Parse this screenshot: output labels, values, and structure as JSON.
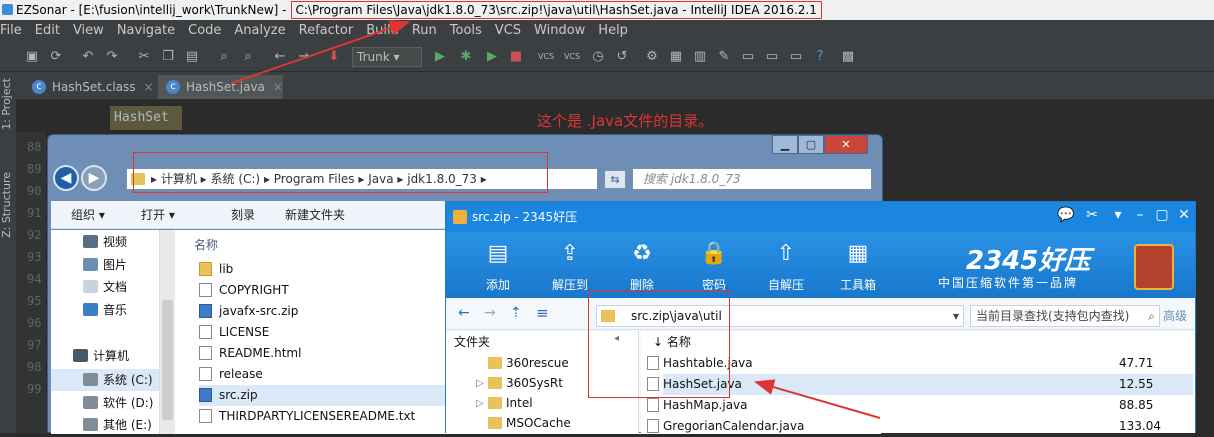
{
  "ide": {
    "title_prefix": "EZSonar - [E:\\fusion\\intellij_work\\TrunkNew]",
    "title_sep": "-",
    "title_highlight": "C:\\Program Files\\Java\\jdk1.8.0_73\\src.zip!\\java\\util\\HashSet.java - IntelliJ IDEA 2016.2.1",
    "menu": [
      "File",
      "Edit",
      "View",
      "Navigate",
      "Code",
      "Analyze",
      "Refactor",
      "Build",
      "Run",
      "Tools",
      "VCS",
      "Window",
      "Help"
    ],
    "vcs_branch": "Trunk",
    "vcs1": "VCS",
    "vcs2": "VCS",
    "side_project": "1: Project",
    "side_structure": "Z: Structure",
    "tabs": [
      {
        "label": "HashSet.class",
        "close": "×"
      },
      {
        "label": "HashSet.java",
        "close": "×"
      }
    ],
    "breadcrumb": "HashSet",
    "line_numbers": [
      "88",
      "89",
      "90",
      "91",
      "92",
      "93",
      "94",
      "95",
      "96",
      "97",
      "98",
      "99"
    ],
    "annotation": "这个是 .Java文件的目录。"
  },
  "explorer": {
    "address": [
      "计算机",
      "系统 (C:)",
      "Program Files",
      "Java",
      "jdk1.8.0_73"
    ],
    "search_placeholder": "搜索 jdk1.8.0_73",
    "commands": {
      "organize": "组织 ▾",
      "open": "打开 ▾",
      "burn": "刻录",
      "new_folder": "新建文件夹"
    },
    "nav": [
      {
        "label": "视频",
        "color": "#5a6d86"
      },
      {
        "label": "图片",
        "color": "#6a8fb0"
      },
      {
        "label": "文档",
        "color": "#c7d3df"
      },
      {
        "label": "音乐",
        "color": "#3c7dc9"
      },
      {
        "label": "计算机",
        "color": "#4a5968"
      },
      {
        "label": "系统 (C:)",
        "color": "#7f8c99"
      },
      {
        "label": "软件 (D:)",
        "color": "#7f8c99"
      },
      {
        "label": "其他 (E:)",
        "color": "#7f8c99"
      }
    ],
    "column_name": "名称",
    "files": [
      {
        "name": "lib",
        "type": "f"
      },
      {
        "name": "COPYRIGHT",
        "type": "d"
      },
      {
        "name": "javafx-src.zip",
        "type": "z"
      },
      {
        "name": "LICENSE",
        "type": "d"
      },
      {
        "name": "README.html",
        "type": "d"
      },
      {
        "name": "release",
        "type": "d"
      },
      {
        "name": "src.zip",
        "type": "z"
      },
      {
        "name": "THIRDPARTYLICENSEREADME.txt",
        "type": "d"
      }
    ]
  },
  "zip": {
    "title": "src.zip - 2345好压",
    "toolbar": [
      {
        "label": "添加",
        "glyph": "▤",
        "icon": "add-icon"
      },
      {
        "label": "解压到",
        "glyph": "⇪",
        "icon": "extract-icon"
      },
      {
        "label": "删除",
        "glyph": "♻",
        "icon": "delete-icon"
      },
      {
        "label": "密码",
        "glyph": "🔒",
        "icon": "lock-icon"
      },
      {
        "label": "自解压",
        "glyph": "⇧",
        "icon": "self-extract-icon"
      },
      {
        "label": "工具箱",
        "glyph": "▦",
        "icon": "toolbox-icon"
      }
    ],
    "brand": "2345好压",
    "brand_tagline": "中国压缩软件第一品牌",
    "path": "src.zip\\java\\util",
    "search_placeholder": "当前目录查找(支持包内查找)",
    "search_adv": "高级",
    "left_header": "文件夹",
    "folders": [
      {
        "name": "360rescue",
        "arrow": ""
      },
      {
        "name": "360SysRt",
        "arrow": "▷"
      },
      {
        "name": "Intel",
        "arrow": "▷"
      },
      {
        "name": "MSOCache",
        "arrow": ""
      }
    ],
    "col_name": "名称",
    "files": [
      {
        "name": "Hashtable.java",
        "size": "47.71"
      },
      {
        "name": "HashSet.java",
        "size": "12.55"
      },
      {
        "name": "HashMap.java",
        "size": "88.85"
      },
      {
        "name": "GregorianCalendar.java",
        "size": "133.04"
      }
    ]
  },
  "colors": {
    "annotation_red": "#e03434",
    "zip_blue": "#1a86e0",
    "ide_dark": "#2b2b2b"
  }
}
